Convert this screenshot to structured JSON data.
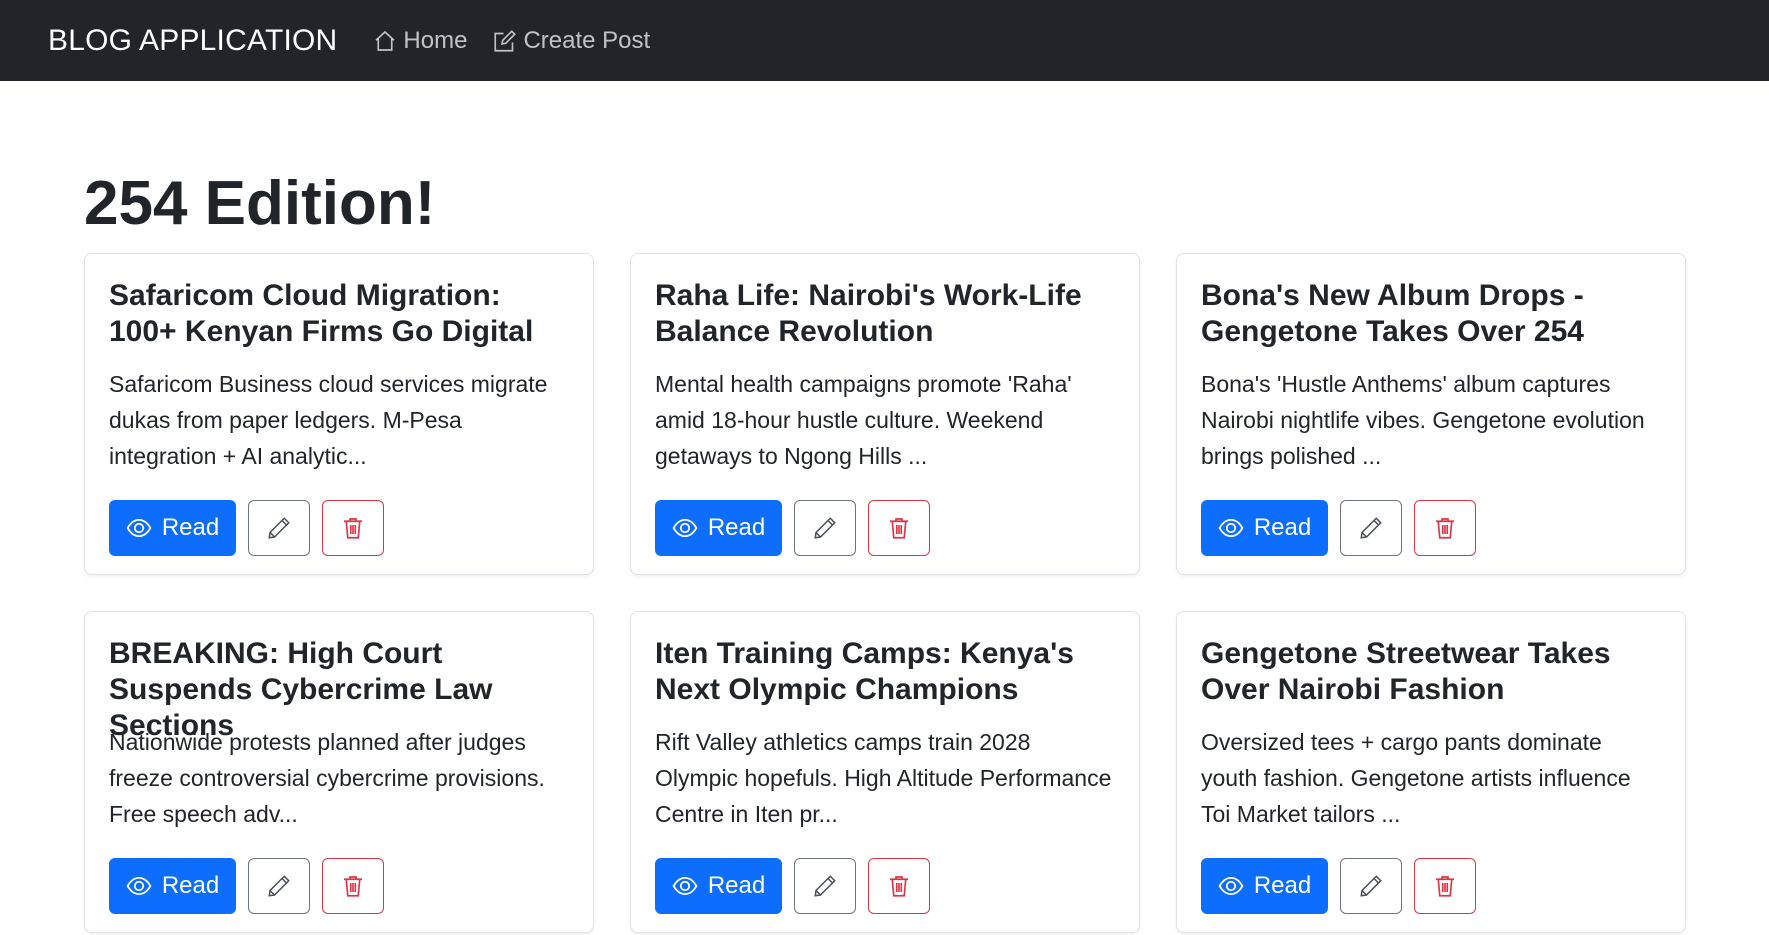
{
  "navbar": {
    "brand": "BLOG APPLICATION",
    "links": [
      {
        "label": "Home",
        "icon": "house-icon"
      },
      {
        "label": "Create Post",
        "icon": "pencil-square-icon"
      }
    ]
  },
  "page": {
    "title": "254 Edition!"
  },
  "buttons": {
    "read_label": "Read"
  },
  "posts": [
    {
      "title": "Safaricom Cloud Migration: 100+ Kenyan Firms Go Digital",
      "excerpt": "Safaricom Business cloud services migrate dukas from paper ledgers. M-Pesa integration + AI analytic..."
    },
    {
      "title": "Raha Life: Nairobi's Work-Life Balance Revolution",
      "excerpt": "Mental health campaigns promote 'Raha' amid 18-hour hustle culture. Weekend getaways to Ngong Hills ..."
    },
    {
      "title": "Bona's New Album Drops - Gengetone Takes Over 254",
      "excerpt": "Bona's 'Hustle Anthems' album captures Nairobi nightlife vibes. Gengetone evolution brings polished ..."
    },
    {
      "title": "BREAKING: High Court Suspends Cybercrime Law Sections",
      "excerpt": "Nationwide protests planned after judges freeze controversial cybercrime provisions. Free speech adv..."
    },
    {
      "title": "Iten Training Camps: Kenya's Next Olympic Champions",
      "excerpt": "Rift Valley athletics camps train 2028 Olympic hopefuls. High Altitude Performance Centre in Iten pr..."
    },
    {
      "title": "Gengetone Streetwear Takes Over Nairobi Fashion",
      "excerpt": "Oversized tees + cargo pants dominate youth fashion. Gengetone artists influence Toi Market tailors ..."
    }
  ],
  "colors": {
    "navbar_bg": "#212529",
    "primary": "#0d6efd",
    "danger": "#dc3545",
    "secondary": "#6c757d"
  }
}
